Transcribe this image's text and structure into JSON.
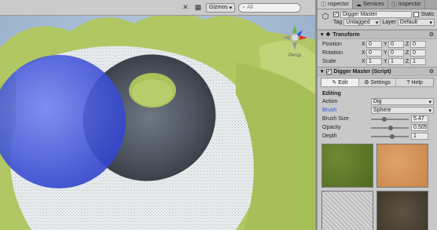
{
  "scene": {
    "toolbar": {
      "tools_icon": "crossed-tools-icon",
      "gizmos_label": "Gizmos",
      "search_placeholder": "All"
    },
    "gizmo": {
      "label": "Persp"
    }
  },
  "inspector": {
    "tabs": [
      {
        "label": "nspector",
        "icon": "info-icon"
      },
      {
        "label": "Services",
        "icon": "cloud-icon"
      },
      {
        "label": "Inspector",
        "icon": "info-icon"
      }
    ],
    "object": {
      "name": "Digger Master",
      "static_label": "Static",
      "tag_label": "Tag",
      "tag_value": "Untagged",
      "layer_label": "Layer",
      "layer_value": "Default"
    },
    "transform": {
      "title": "Transform",
      "rows": [
        {
          "label": "Position",
          "x": "0",
          "y": "0",
          "z": "0"
        },
        {
          "label": "Rotation",
          "x": "0",
          "y": "0",
          "z": "0"
        },
        {
          "label": "Scale",
          "x": "1",
          "y": "1",
          "z": "1"
        }
      ]
    },
    "digger": {
      "title": "Digger Master (Script)",
      "subtabs": [
        "Edit",
        "Settings",
        "Help"
      ],
      "section_label": "Editing",
      "action_label": "Action",
      "action_value": "Dig",
      "brush_label": "Brush",
      "brush_value": "Sphere",
      "brush_size_label": "Brush Size",
      "brush_size_value": "5.47",
      "opacity_label": "Opacity",
      "opacity_value": "0.505",
      "depth_label": "Depth",
      "depth_value": "1"
    },
    "textures": [
      "grass",
      "sand",
      "gravel",
      "dirt"
    ]
  },
  "colors": {
    "brush_label_blue": "#2a5cc8",
    "sphere_blue": "#4a5fe0",
    "terrain_green": "#a7c25a",
    "snow_white": "#e8ecee"
  }
}
